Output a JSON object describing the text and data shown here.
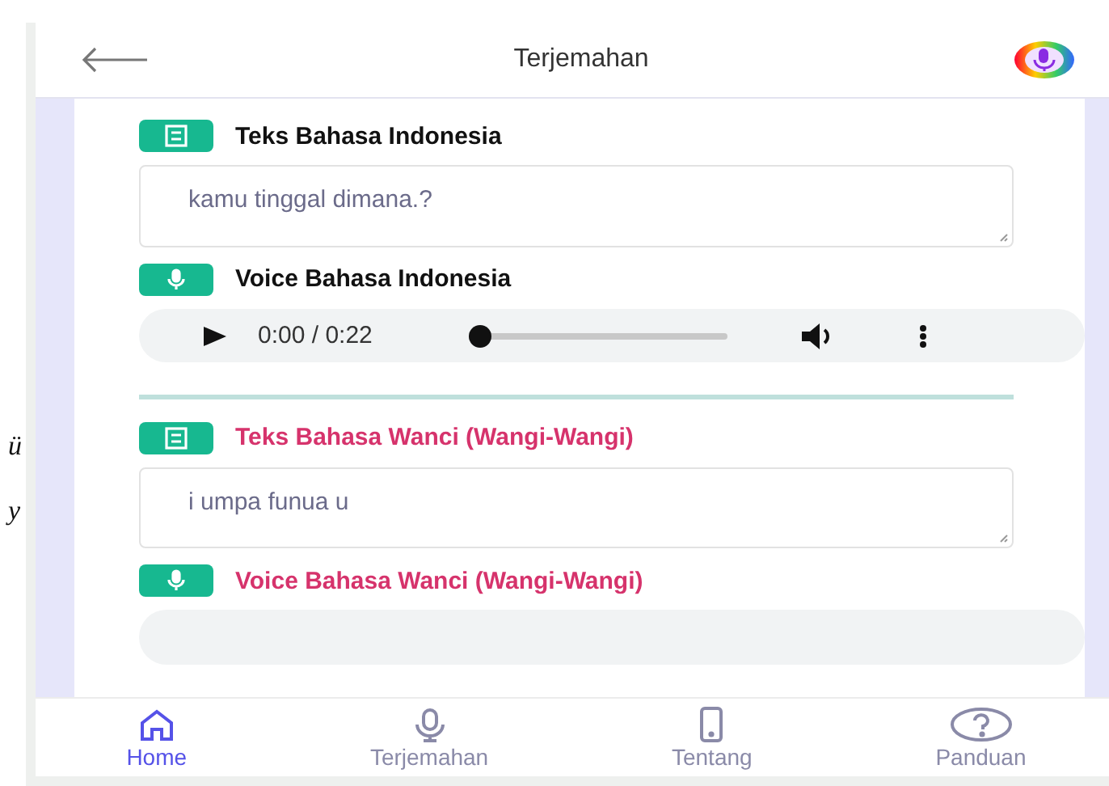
{
  "stray_text": [
    "ü",
    "y"
  ],
  "header": {
    "title": "Terjemahan"
  },
  "sections": [
    {
      "kind": "text",
      "label": "Teks Bahasa Indonesia",
      "color": "#111111",
      "value": "kamu tinggal dimana.?"
    },
    {
      "kind": "audio",
      "label": "Voice Bahasa Indonesia",
      "color": "#111111",
      "time": "0:00 / 0:22",
      "level": 0
    },
    {
      "kind": "divider"
    },
    {
      "kind": "text",
      "label": "Teks Bahasa Wanci (Wangi-Wangi)",
      "color": "#d6336c",
      "value": "i umpa funua u"
    },
    {
      "kind": "audio",
      "label": "Voice Bahasa Wanci (Wangi-Wangi)",
      "color": "#d6336c"
    }
  ],
  "nav": [
    {
      "label": "Home",
      "selected": true
    },
    {
      "label": "Terjemahan",
      "selected": false
    },
    {
      "label": "Tentang",
      "selected": false
    },
    {
      "label": "Panduan",
      "selected": false
    }
  ]
}
